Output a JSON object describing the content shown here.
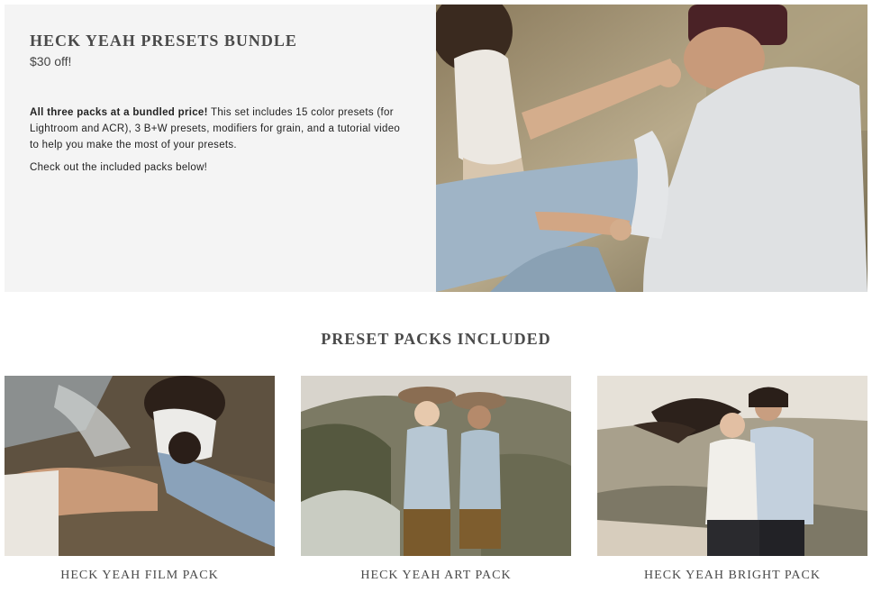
{
  "bundle": {
    "title": "HECK YEAH PRESETS BUNDLE",
    "subtitle": "$30 off!",
    "description_bold": "All three packs at a bundled price!",
    "description_rest": " This set includes 15 color presets (for Lightroom and ACR), 3 B+W presets, modifiers for grain, and a tutorial video to help you make the most of your presets.",
    "cta": "Check out the included packs below!"
  },
  "section": {
    "heading": "PRESET PACKS INCLUDED"
  },
  "packs": [
    {
      "label": "HECK YEAH FILM PACK"
    },
    {
      "label": "HECK YEAH ART PACK"
    },
    {
      "label": "HECK YEAH BRIGHT PACK"
    }
  ],
  "colors": {
    "hero_bg": "#f4f4f4",
    "heading_text": "#4a4a4a"
  }
}
